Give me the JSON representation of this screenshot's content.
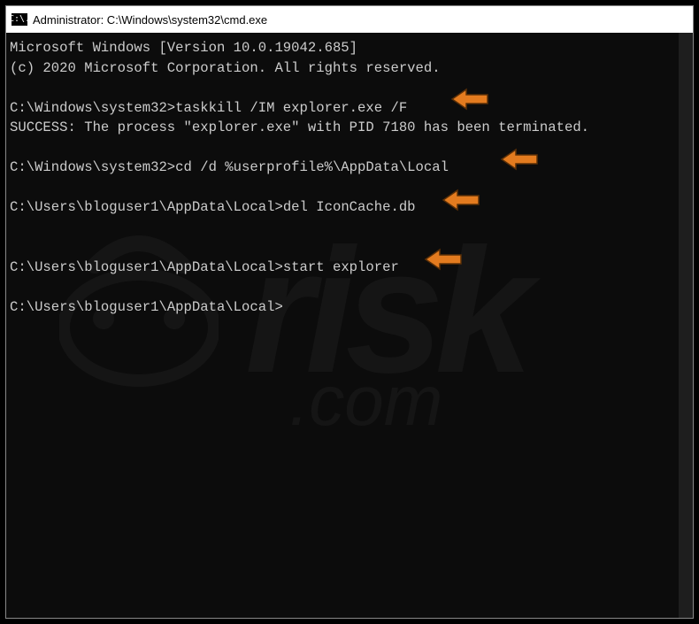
{
  "window": {
    "title": "Administrator: C:\\Windows\\system32\\cmd.exe",
    "icon_label": "C:\\."
  },
  "terminal": {
    "line1": "Microsoft Windows [Version 10.0.19042.685]",
    "line2": "(c) 2020 Microsoft Corporation. All rights reserved.",
    "blank": "",
    "prompt1_path": "C:\\Windows\\system32>",
    "cmd1": "taskkill /IM explorer.exe /F",
    "result1": "SUCCESS: The process \"explorer.exe\" with PID 7180 has been terminated.",
    "prompt2_path": "C:\\Windows\\system32>",
    "cmd2": "cd /d %userprofile%\\AppData\\Local",
    "prompt3_path": "C:\\Users\\bloguser1\\AppData\\Local>",
    "cmd3": "del IconCache.db",
    "prompt4_path": "C:\\Users\\bloguser1\\AppData\\Local>",
    "cmd4": "start explorer",
    "prompt5_path": "C:\\Users\\bloguser1\\AppData\\Local>"
  },
  "watermark": {
    "text": "risk",
    "suffix": ".com"
  },
  "arrow_color": "#e37b1f",
  "arrow_stroke": "#5a2f07"
}
